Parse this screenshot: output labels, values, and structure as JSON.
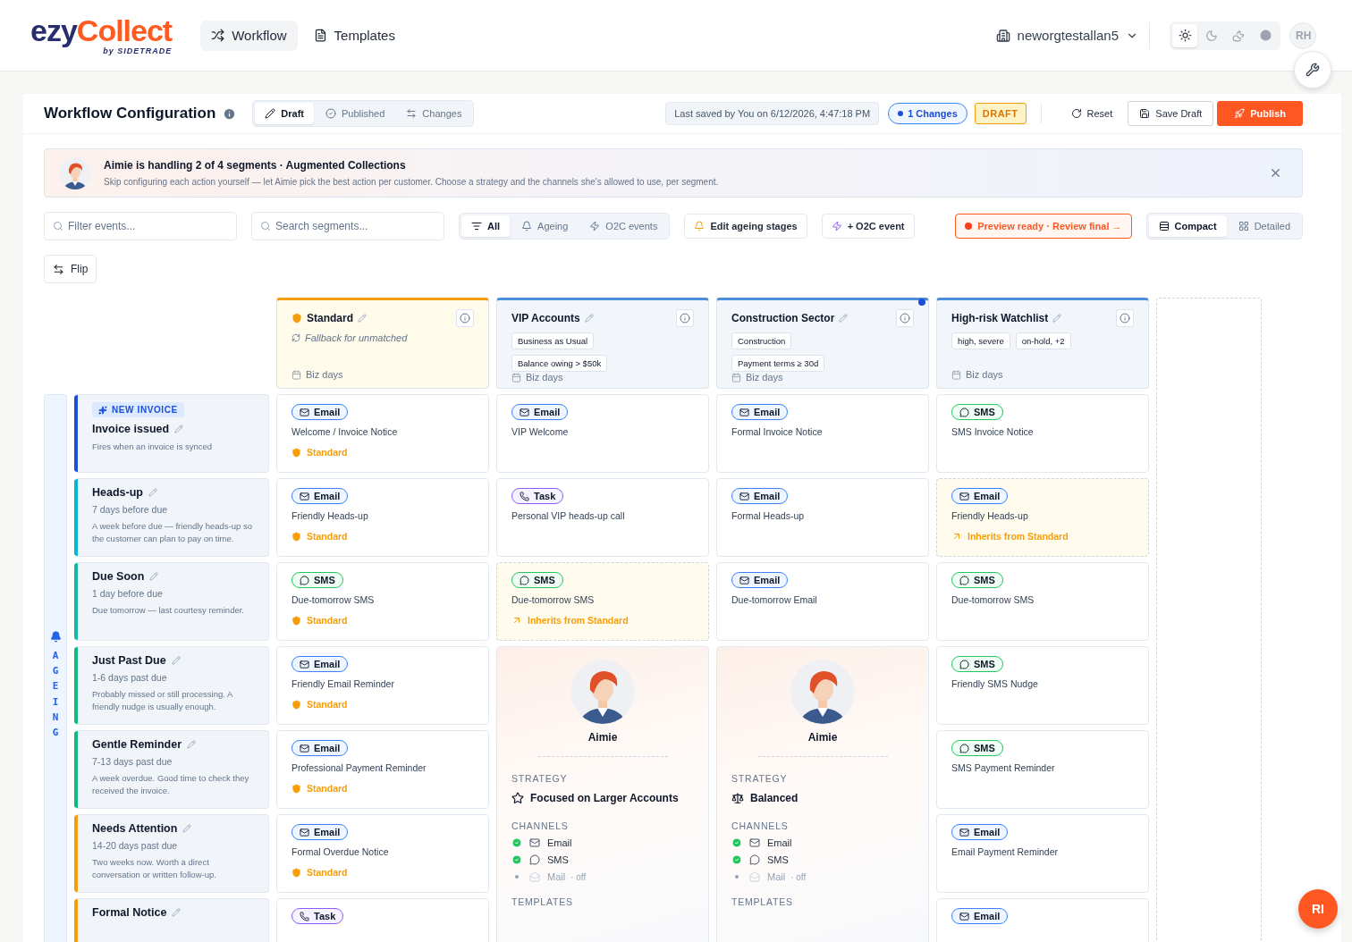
{
  "logo": {
    "name_start": "ezy",
    "name_end": "Collect",
    "tagline": "by SIDETRADE"
  },
  "nav": [
    {
      "label": "Workflow",
      "kind": "shuffle",
      "selected": true
    },
    {
      "label": "Templates",
      "kind": "file",
      "selected": false
    }
  ],
  "org": "neworgtestallan5",
  "theme_modes": [
    {
      "kind": "sun",
      "selected": true
    },
    {
      "kind": "moon",
      "selected": false
    },
    {
      "kind": "cloud",
      "selected": false
    },
    {
      "kind": "dot",
      "selected": false
    }
  ],
  "avatar": "RH",
  "assistant_button": "RI",
  "config": {
    "title": "Workflow Configuration",
    "tabs": [
      {
        "label": "Draft",
        "kind": "pencil",
        "selected": true
      },
      {
        "label": "Published",
        "kind": "check",
        "selected": false
      },
      {
        "label": "Changes",
        "kind": "swap",
        "selected": false
      }
    ],
    "last_saved": "Last saved by You on 6/12/2026, 4:47:18 PM",
    "changes": "1 Changes",
    "status": "DRAFT",
    "actions": [
      {
        "label": "Reset",
        "kind": "reset"
      },
      {
        "label": "Save Draft",
        "kind": "save"
      },
      {
        "label": "Publish",
        "kind": "publish"
      }
    ]
  },
  "banner": {
    "title": "Aimie is handling 2 of 4 segments · Augmented Collections",
    "text": "Skip configuring each action yourself — let Aimie pick the best action per customer. Choose a strategy and the channels she's allowed to use, per segment."
  },
  "filters": {
    "event_placeholder": "Filter events...",
    "segment_placeholder": "Search segments...",
    "types": [
      {
        "label": "All",
        "kind": "filter",
        "selected": true
      },
      {
        "label": "Ageing",
        "kind": "bell",
        "selected": false
      },
      {
        "label": "O2C events",
        "kind": "zap",
        "selected": false
      }
    ],
    "edit_stages": "Edit ageing stages",
    "add_event": "+ O2C event",
    "preview": "Preview ready · Review final →",
    "views": [
      {
        "label": "Compact",
        "kind": "rows",
        "selected": true
      },
      {
        "label": "Detailed",
        "kind": "grid",
        "selected": false
      }
    ]
  },
  "flip": "Flip",
  "group_label": "AGEING",
  "segments": [
    {
      "name": "Standard",
      "kind": "fallback",
      "note": "Fallback for unmatched",
      "footer": "Biz days",
      "color": "#f59e0b",
      "changed": false
    },
    {
      "name": "VIP Accounts",
      "kind": "rule",
      "tags": [
        "Business as Usual",
        "Balance owing > $50k"
      ],
      "footer": "Biz days",
      "color": "#4a90d9",
      "changed": false,
      "agent": {
        "name": "Aimie",
        "strategy_label": "STRATEGY",
        "strategy": {
          "label": "Focused on Larger Accounts",
          "kind": "star"
        },
        "channels_label": "CHANNELS",
        "channels": [
          {
            "name": "Email",
            "kind": "email",
            "on": true
          },
          {
            "name": "SMS",
            "kind": "sms",
            "on": true
          },
          {
            "name": "Mail",
            "kind": "mail",
            "on": false,
            "note": "· off"
          }
        ],
        "templates_label": "TEMPLATES"
      }
    },
    {
      "name": "Construction Sector",
      "kind": "rule",
      "tags": [
        "Construction",
        "Payment terms ≥ 30d"
      ],
      "footer": "Biz days",
      "color": "#4a90d9",
      "changed": true,
      "agent": {
        "name": "Aimie",
        "strategy_label": "STRATEGY",
        "strategy": {
          "label": "Balanced",
          "kind": "scale"
        },
        "channels_label": "CHANNELS",
        "channels": [
          {
            "name": "Email",
            "kind": "email",
            "on": true
          },
          {
            "name": "SMS",
            "kind": "sms",
            "on": true
          },
          {
            "name": "Mail",
            "kind": "mail",
            "on": false,
            "note": "· off"
          }
        ],
        "templates_label": "TEMPLATES"
      }
    },
    {
      "name": "High-risk Watchlist",
      "kind": "rule",
      "tags": [
        "high, severe",
        "on-hold, +2"
      ],
      "footer": "Biz days",
      "color": "#4a90d9",
      "changed": false
    }
  ],
  "events": [
    {
      "badge": "NEW INVOICE",
      "name": "Invoice issued",
      "description": "Fires when an invoice is synced",
      "color": "#1d4ed8",
      "cells": [
        {
          "kind": "email",
          "channel": "Email",
          "template": "Welcome / Invoice Notice",
          "origin": "Standard",
          "inherited": false
        },
        {
          "kind": "email",
          "channel": "Email",
          "template": "VIP Welcome",
          "inherited": false
        },
        {
          "kind": "email",
          "channel": "Email",
          "template": "Formal Invoice Notice",
          "inherited": false
        },
        {
          "kind": "sms",
          "channel": "SMS",
          "template": "SMS Invoice Notice",
          "inherited": false
        }
      ]
    },
    {
      "name": "Heads-up",
      "timing": "7 days before due",
      "description": "A week before due — friendly heads-up so the customer can plan to pay on time.",
      "color": "#06b6d4",
      "cells": [
        {
          "kind": "email",
          "channel": "Email",
          "template": "Friendly Heads-up",
          "origin": "Standard",
          "inherited": false
        },
        {
          "kind": "task",
          "channel": "Task",
          "template": "Personal VIP heads-up call",
          "inherited": false
        },
        {
          "kind": "email",
          "channel": "Email",
          "template": "Formal Heads-up",
          "inherited": false
        },
        {
          "kind": "email",
          "channel": "Email",
          "template": "Friendly Heads-up",
          "origin": "Inherits from Standard",
          "inherited": true
        }
      ]
    },
    {
      "name": "Due Soon",
      "timing": "1 day before due",
      "description": "Due tomorrow — last courtesy reminder.",
      "color": "#14b8a6",
      "cells": [
        {
          "kind": "sms",
          "channel": "SMS",
          "template": "Due-tomorrow SMS",
          "origin": "Standard",
          "inherited": false
        },
        {
          "kind": "sms",
          "channel": "SMS",
          "template": "Due-tomorrow SMS",
          "origin": "Inherits from Standard",
          "inherited": true
        },
        {
          "kind": "email",
          "channel": "Email",
          "template": "Due-tomorrow Email",
          "inherited": false
        },
        {
          "kind": "sms",
          "channel": "SMS",
          "template": "Due-tomorrow SMS",
          "inherited": false
        }
      ]
    },
    {
      "name": "Just Past Due",
      "timing": "1-6 days past due",
      "description": "Probably missed or still processing. A friendly nudge is usually enough.",
      "color": "#10b981",
      "cells": [
        {
          "kind": "email",
          "channel": "Email",
          "template": "Friendly Email Reminder",
          "origin": "Standard",
          "inherited": false
        },
        {
          "kind": "agent"
        },
        {
          "kind": "agent"
        },
        {
          "kind": "sms",
          "channel": "SMS",
          "template": "Friendly SMS Nudge",
          "inherited": false
        }
      ]
    },
    {
      "name": "Gentle Reminder",
      "timing": "7-13 days past due",
      "description": "A week overdue. Good time to check they received the invoice.",
      "color": "#10b981",
      "cells": [
        {
          "kind": "email",
          "channel": "Email",
          "template": "Professional Payment Reminder",
          "origin": "Standard",
          "inherited": false
        },
        {
          "kind": "agent"
        },
        {
          "kind": "agent"
        },
        {
          "kind": "sms",
          "channel": "SMS",
          "template": "SMS Payment Reminder",
          "inherited": false
        }
      ]
    },
    {
      "name": "Needs Attention",
      "timing": "14-20 days past due",
      "description": "Two weeks now. Worth a direct conversation or written follow-up.",
      "color": "#f59e0b",
      "cells": [
        {
          "kind": "email",
          "channel": "Email",
          "template": "Formal Overdue Notice",
          "origin": "Standard",
          "inherited": false
        },
        {
          "kind": "agent"
        },
        {
          "kind": "agent"
        },
        {
          "kind": "email",
          "channel": "Email",
          "template": "Email Payment Reminder",
          "inherited": false
        }
      ]
    },
    {
      "name": "Formal Notice",
      "color": "#f59e0b",
      "cells": [
        {
          "kind": "task",
          "channel": "Task",
          "inherited": false
        },
        {
          "kind": "agent"
        },
        {
          "kind": "agent"
        },
        {
          "kind": "email",
          "channel": "Email",
          "inherited": false
        }
      ]
    }
  ]
}
